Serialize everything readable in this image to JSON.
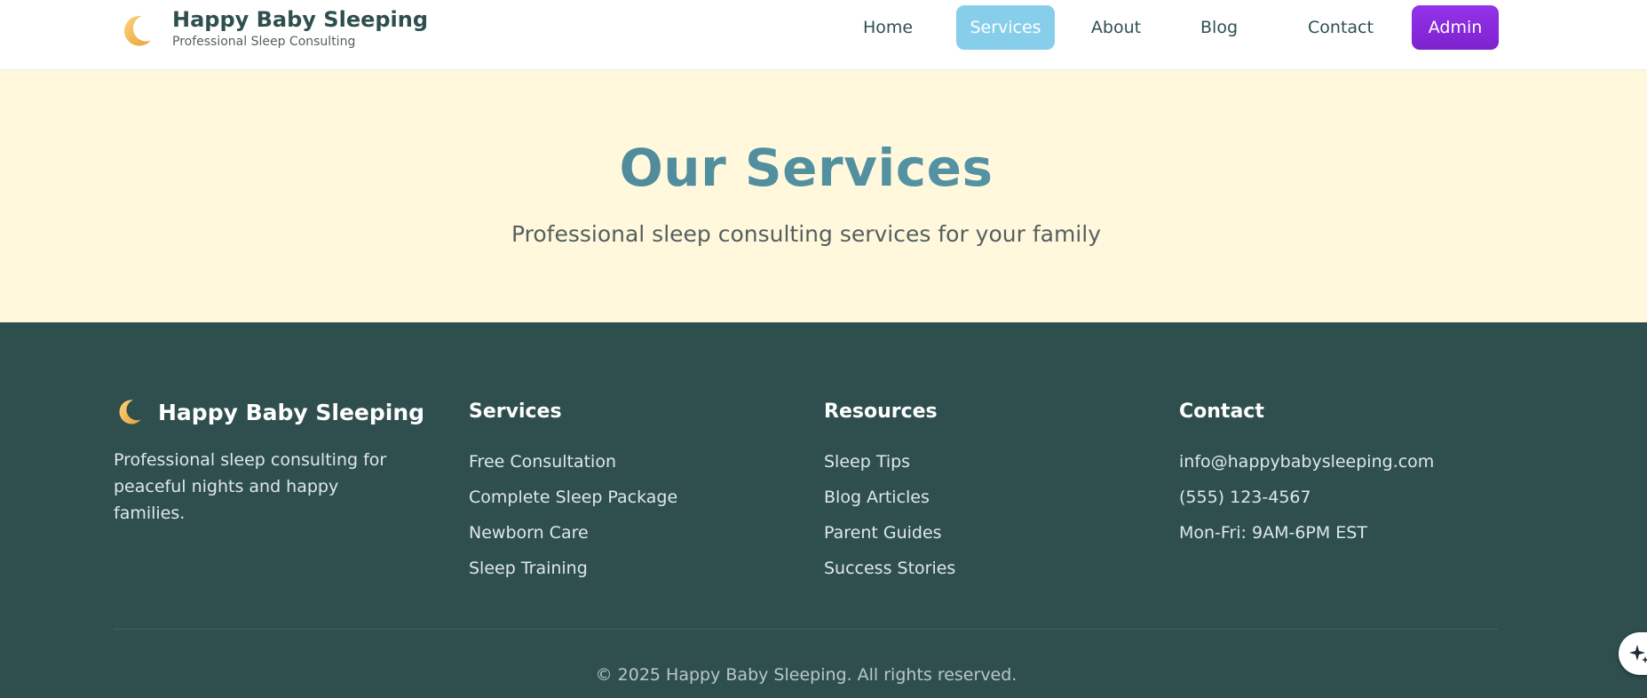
{
  "header": {
    "brand_title": "Happy Baby Sleeping",
    "brand_subtitle": "Professional Sleep Consulting",
    "brand_icon": "crescent-moon-icon",
    "nav": {
      "home": "Home",
      "services": "Services",
      "about": "About",
      "blog": "Blog",
      "contact": "Contact",
      "admin": "Admin"
    },
    "active_nav": "services"
  },
  "hero": {
    "title": "Our Services",
    "subtitle": "Professional sleep consulting services for your family"
  },
  "footer": {
    "brand_title": "Happy Baby Sleeping",
    "brand_desc": "Professional sleep consulting for peaceful nights and happy families.",
    "services": {
      "title": "Services",
      "links": [
        "Free Consultation",
        "Complete Sleep Package",
        "Newborn Care",
        "Sleep Training"
      ]
    },
    "resources": {
      "title": "Resources",
      "links": [
        "Sleep Tips",
        "Blog Articles",
        "Parent Guides",
        "Success Stories"
      ]
    },
    "contact": {
      "title": "Contact",
      "items": [
        "info@happybabysleeping.com",
        "(555) 123-4567",
        "Mon-Fri: 9AM-6PM EST"
      ]
    },
    "copyright": "© 2025 Happy Baby Sleeping. All rights reserved."
  },
  "colors": {
    "primary_dark": "#2f4f4f",
    "hero_bg": "#fff8dc",
    "nav_active": "#87ceeb",
    "admin": "#8a2be2",
    "title_teal": "#4a8a99"
  },
  "fab_icon": "sparkle-icon"
}
